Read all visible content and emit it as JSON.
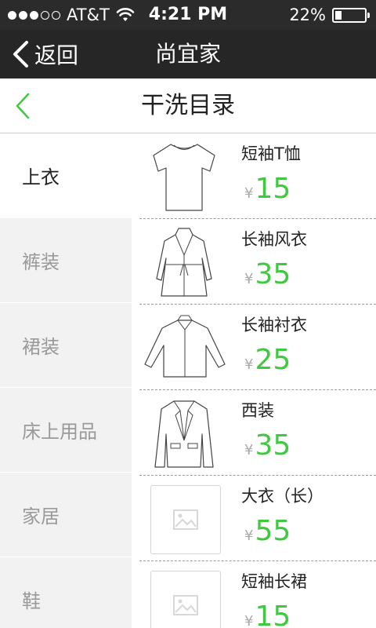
{
  "status_bar": {
    "carrier": "AT&T",
    "time": "4:21 PM",
    "battery": "22%",
    "battery_level": 0.22,
    "signal_bars_full": 3,
    "signal_bars_total": 5
  },
  "nav": {
    "back_label": "返回",
    "title": "尚宜家"
  },
  "page": {
    "title": "干洗目录"
  },
  "colors": {
    "accent": "#3fc940",
    "nav_bg": "#262626",
    "sidebar_bg": "#f2f2f2"
  },
  "categories": [
    {
      "label": "上衣",
      "active": true
    },
    {
      "label": "裤装",
      "active": false
    },
    {
      "label": "裙装",
      "active": false
    },
    {
      "label": "床上用品",
      "active": false
    },
    {
      "label": "家居",
      "active": false
    },
    {
      "label": "鞋",
      "active": false
    }
  ],
  "items": [
    {
      "name": "短袖T恤",
      "currency": "¥",
      "price": "15",
      "icon": "tshirt-icon"
    },
    {
      "name": "长袖风衣",
      "currency": "¥",
      "price": "35",
      "icon": "trench-coat-icon"
    },
    {
      "name": "长袖衬衣",
      "currency": "¥",
      "price": "25",
      "icon": "shirt-icon"
    },
    {
      "name": "西装",
      "currency": "¥",
      "price": "35",
      "icon": "suit-jacket-icon"
    },
    {
      "name": "大衣（长）",
      "currency": "¥",
      "price": "55",
      "icon": "image-placeholder-icon"
    },
    {
      "name": "短袖长裙",
      "currency": "¥",
      "price": "15",
      "icon": "image-placeholder-icon"
    }
  ]
}
